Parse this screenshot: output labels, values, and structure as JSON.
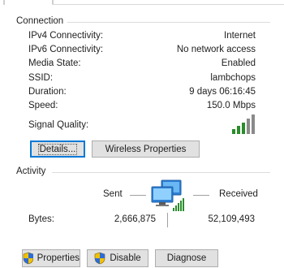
{
  "connection": {
    "title": "Connection",
    "rows": [
      {
        "label": "IPv4 Connectivity:",
        "value": "Internet"
      },
      {
        "label": "IPv6 Connectivity:",
        "value": "No network access"
      },
      {
        "label": "Media State:",
        "value": "Enabled"
      },
      {
        "label": "SSID:",
        "value": "lambchops"
      },
      {
        "label": "Duration:",
        "value": "9 days 06:16:45"
      },
      {
        "label": "Speed:",
        "value": "150.0 Mbps"
      }
    ],
    "signal_label": "Signal Quality:",
    "signal_bars_lit": 3,
    "signal_bars_total": 5
  },
  "buttons": {
    "details": "Details...",
    "wireless_properties": "Wireless Properties",
    "properties": "Properties",
    "disable": "Disable",
    "diagnose": "Diagnose"
  },
  "activity": {
    "title": "Activity",
    "sent_label": "Sent",
    "received_label": "Received",
    "bytes_label": "Bytes:",
    "bytes_sent": "2,666,875",
    "bytes_received": "52,109,493"
  },
  "colors": {
    "signal_green": "#2a8c2a",
    "accent": "#0078d7",
    "button_face": "#e1e1e1"
  }
}
